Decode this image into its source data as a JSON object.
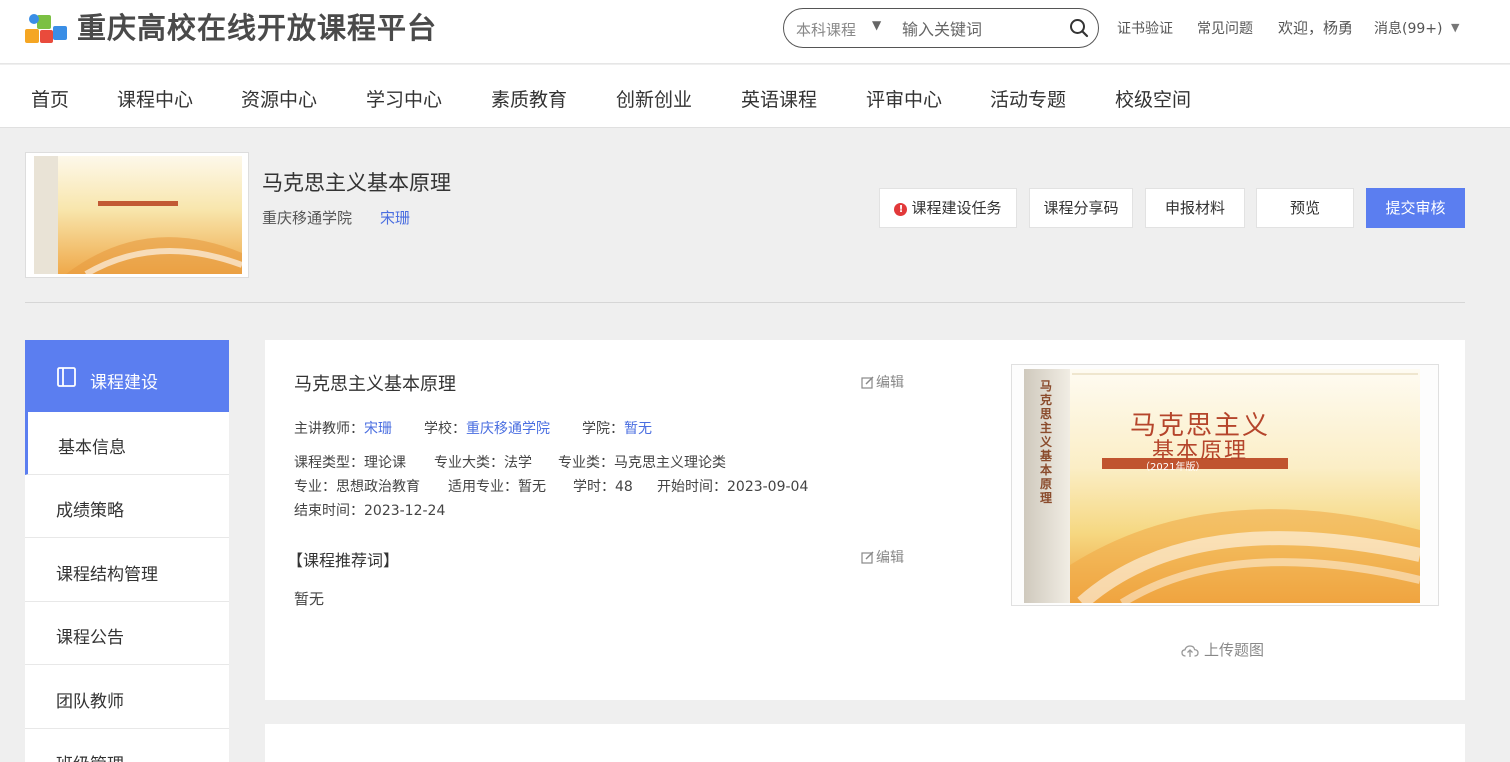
{
  "header": {
    "logo_text": "重庆高校在线开放课程平台",
    "search": {
      "type_label": "本科课程",
      "placeholder": "输入关键词"
    },
    "links": {
      "cert": "证书验证",
      "faq": "常见问题",
      "welcome": "欢迎，杨勇",
      "messages": "消息(99+)",
      "messages_caret": "▼"
    }
  },
  "nav": {
    "items": [
      "首页",
      "课程中心",
      "资源中心",
      "学习中心",
      "素质教育",
      "创新创业",
      "英语课程",
      "评审中心",
      "活动专题",
      "校级空间"
    ]
  },
  "course": {
    "title": "马克思主义基本原理",
    "school": "重庆移通学院",
    "teacher": "宋珊",
    "cover_title_line1": "马克思主义",
    "cover_title_line2": "基本原理",
    "cover_edition": "（2021年版）",
    "cover_spine": "马克思主义基本原理"
  },
  "actions": {
    "task": "课程建设任务",
    "share": "课程分享码",
    "materials": "申报材料",
    "preview": "预览",
    "submit": "提交审核"
  },
  "sidebar": {
    "header": "课程建设",
    "items": [
      "基本信息",
      "成绩策略",
      "课程结构管理",
      "课程公告",
      "团队教师",
      "班级管理"
    ]
  },
  "info": {
    "title": "马克思主义基本原理",
    "edit_label": "编辑",
    "lecturer_label": "主讲教师：",
    "lecturer": "宋珊",
    "school_label": "学校：",
    "school": "重庆移通学院",
    "college_label": "学院：",
    "college": "暂无",
    "course_type": "课程类型：理论课",
    "major_category": "专业大类：法学",
    "major_class": "专业类：马克思主义理论类",
    "major": "专业：思想政治教育",
    "applicable_major": "适用专业：暂无",
    "hours": "学时：48",
    "start_time": "开始时间：2023-09-04",
    "end_time": "结束时间：2023-12-24",
    "recommend_title": "【课程推荐词】",
    "recommend_text": "暂无",
    "upload_label": "上传题图"
  },
  "colors": {
    "accent": "#5b7ef0",
    "link": "#4a6ee0",
    "warning": "#e2393a"
  }
}
